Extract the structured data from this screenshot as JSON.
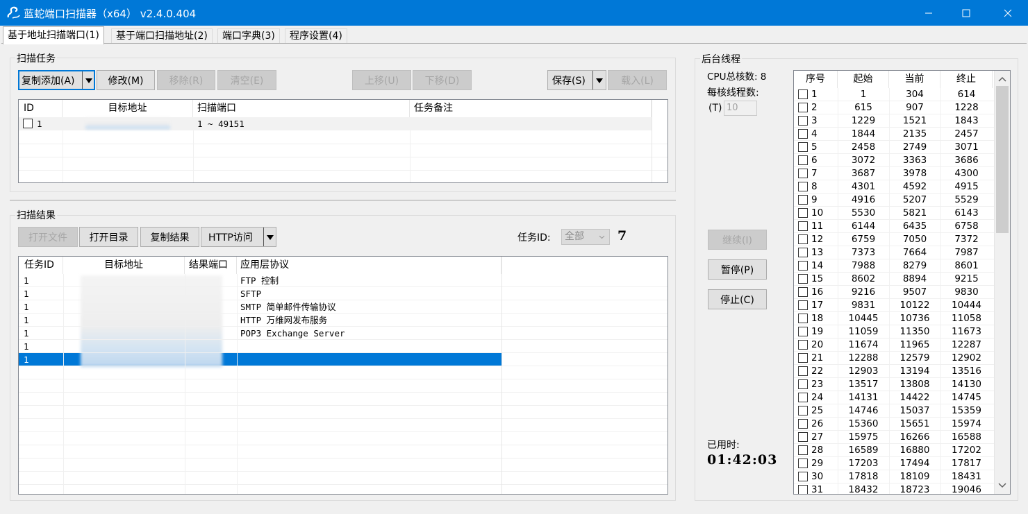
{
  "window": {
    "title": "蓝蛇端口扫描器（x64） v2.4.0.404"
  },
  "tabs": [
    {
      "label": "基于地址扫描端口(1)"
    },
    {
      "label": "基于端口扫描地址(2)"
    },
    {
      "label": "端口字典(3)"
    },
    {
      "label": "程序设置(4)"
    }
  ],
  "tasks": {
    "group_label": "扫描任务",
    "buttons": {
      "copy_add": "复制添加(A)",
      "modify": "修改(M)",
      "remove": "移除(R)",
      "clear": "清空(E)",
      "up": "上移(U)",
      "down": "下移(D)",
      "save": "保存(S)",
      "load": "载入(L)"
    },
    "columns": [
      "ID",
      "目标地址",
      "扫描端口",
      "任务备注"
    ],
    "rows": [
      {
        "id": "1",
        "target": "",
        "ports": "1 ~ 49151",
        "note": ""
      }
    ]
  },
  "results": {
    "group_label": "扫描结果",
    "buttons": {
      "open_file": "打开文件",
      "open_dir": "打开目录",
      "copy": "复制结果",
      "http": "HTTP访问"
    },
    "task_id_label": "任务ID:",
    "task_id_value": "全部",
    "count": "7",
    "columns": [
      "任务ID",
      "目标地址",
      "结果端口",
      "应用层协议"
    ],
    "rows": [
      {
        "id": "1",
        "protocol": "FTP 控制"
      },
      {
        "id": "1",
        "protocol": "SFTP"
      },
      {
        "id": "1",
        "protocol": "SMTP 简单邮件传输协议"
      },
      {
        "id": "1",
        "protocol": "HTTP 万维网发布服务"
      },
      {
        "id": "1",
        "protocol": "POP3 Exchange Server"
      },
      {
        "id": "1",
        "protocol": ""
      },
      {
        "id": "1",
        "protocol": ""
      }
    ]
  },
  "threads": {
    "group_label": "后台线程",
    "cpu_label": "CPU总核数: 8",
    "per_core_label": "每核线程数:",
    "t_label": "(T)",
    "t_value": "10",
    "buttons": {
      "continue": "继续(I)",
      "pause": "暂停(P)",
      "stop": "停止(C)"
    },
    "elapsed_label": "已用时:",
    "elapsed_value": "01:42:03",
    "columns": [
      "序号",
      "起始",
      "当前",
      "终止"
    ],
    "rows": [
      [
        "1",
        "1",
        "304",
        "614"
      ],
      [
        "2",
        "615",
        "907",
        "1228"
      ],
      [
        "3",
        "1229",
        "1521",
        "1843"
      ],
      [
        "4",
        "1844",
        "2135",
        "2457"
      ],
      [
        "5",
        "2458",
        "2749",
        "3071"
      ],
      [
        "6",
        "3072",
        "3363",
        "3686"
      ],
      [
        "7",
        "3687",
        "3978",
        "4300"
      ],
      [
        "8",
        "4301",
        "4592",
        "4915"
      ],
      [
        "9",
        "4916",
        "5207",
        "5529"
      ],
      [
        "10",
        "5530",
        "5821",
        "6143"
      ],
      [
        "11",
        "6144",
        "6435",
        "6758"
      ],
      [
        "12",
        "6759",
        "7050",
        "7372"
      ],
      [
        "13",
        "7373",
        "7664",
        "7987"
      ],
      [
        "14",
        "7988",
        "8279",
        "8601"
      ],
      [
        "15",
        "8602",
        "8894",
        "9215"
      ],
      [
        "16",
        "9216",
        "9507",
        "9830"
      ],
      [
        "17",
        "9831",
        "10122",
        "10444"
      ],
      [
        "18",
        "10445",
        "10736",
        "11058"
      ],
      [
        "19",
        "11059",
        "11350",
        "11673"
      ],
      [
        "20",
        "11674",
        "11965",
        "12287"
      ],
      [
        "21",
        "12288",
        "12579",
        "12902"
      ],
      [
        "22",
        "12903",
        "13194",
        "13516"
      ],
      [
        "23",
        "13517",
        "13808",
        "14130"
      ],
      [
        "24",
        "14131",
        "14422",
        "14745"
      ],
      [
        "25",
        "14746",
        "15037",
        "15359"
      ],
      [
        "26",
        "15360",
        "15651",
        "15974"
      ],
      [
        "27",
        "15975",
        "16266",
        "16588"
      ],
      [
        "28",
        "16589",
        "16880",
        "17202"
      ],
      [
        "29",
        "17203",
        "17494",
        "17817"
      ],
      [
        "30",
        "17818",
        "18109",
        "18431"
      ],
      [
        "31",
        "18432",
        "18723",
        "19046"
      ]
    ]
  },
  "colors": {
    "accent": "#0078d7",
    "selected_row": "#0078d7"
  }
}
